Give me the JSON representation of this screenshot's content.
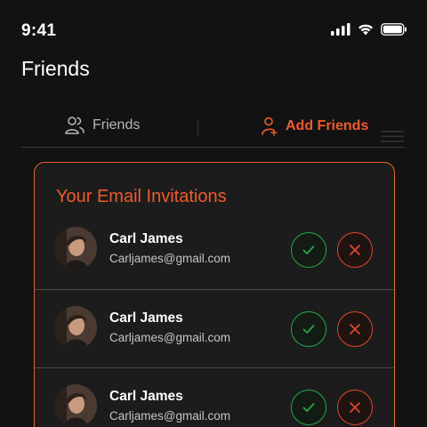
{
  "status_bar": {
    "time": "9:41",
    "icons": [
      "signal-icon",
      "wifi-icon",
      "battery-icon"
    ]
  },
  "page": {
    "title": "Friends"
  },
  "tabs": [
    {
      "label": "Friends",
      "icon": "friends-icon",
      "active": false
    },
    {
      "label": "Add Friends",
      "icon": "add-friend-icon",
      "active": true
    }
  ],
  "invitations": {
    "title": "Your Email Invitations",
    "items": [
      {
        "name": "Carl James",
        "email": "Carljames@gmail.com"
      },
      {
        "name": "Carl James",
        "email": "Carljames@gmail.com"
      },
      {
        "name": "Carl James",
        "email": "Carljames@gmail.com"
      }
    ]
  },
  "colors": {
    "background": "#121212",
    "card": "#1c1c1c",
    "accent": "#f05a2a",
    "accept": "#22a844",
    "reject": "#e0452a",
    "text_muted": "#c4c4c4"
  }
}
